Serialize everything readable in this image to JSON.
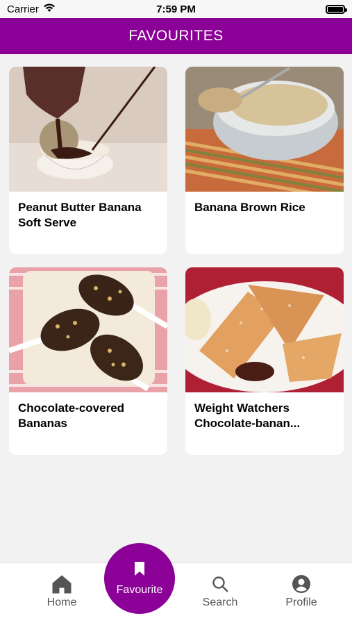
{
  "status_bar": {
    "carrier": "Carrier",
    "time": "7:59 PM"
  },
  "header": {
    "title": "FAVOURITES"
  },
  "favourites": [
    {
      "title": "Peanut Butter Banana Soft Serve"
    },
    {
      "title": "Banana Brown Rice"
    },
    {
      "title": "Chocolate-covered Bananas"
    },
    {
      "title": "Weight Watchers Chocolate-banan..."
    }
  ],
  "tabbar": {
    "home": "Home",
    "favourite": "Favourite",
    "search": "Search",
    "profile": "Profile"
  },
  "colors": {
    "accent": "#8b0096",
    "background": "#f2f2f2"
  }
}
